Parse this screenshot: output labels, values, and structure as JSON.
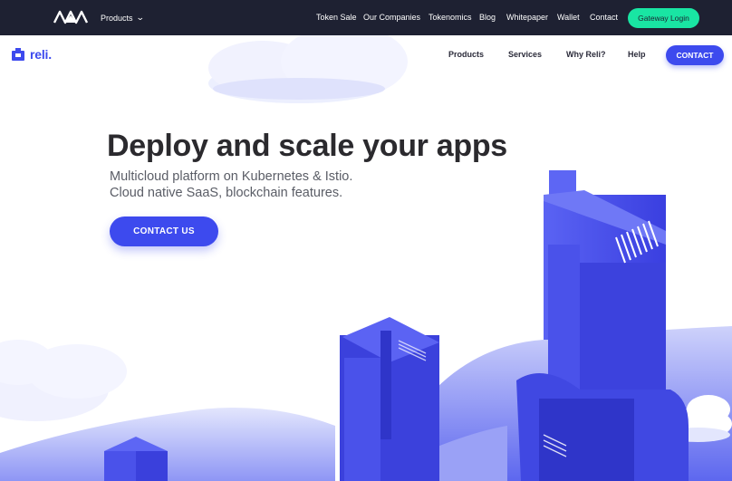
{
  "topbar": {
    "products_label": "Products",
    "links": [
      "Token Sale",
      "Our Companies",
      "Tokenomics",
      "Blog",
      "Whitepaper",
      "Wallet",
      "Contact"
    ],
    "gateway_label": "Gateway Login"
  },
  "nav": {
    "brand": "reli.",
    "links": [
      "Products",
      "Services",
      "Why Reli?",
      "Help"
    ],
    "contact_label": "CONTACT"
  },
  "hero": {
    "title": "Deploy and scale your apps",
    "subtitle_line1": "Multicloud platform on Kubernetes & Istio.",
    "subtitle_line2": "Cloud native SaaS, blockchain features.",
    "cta_label": "CONTACT US"
  },
  "colors": {
    "topbar_bg": "#1e2132",
    "accent": "#3d4aee",
    "gateway": "#19e5a3"
  }
}
